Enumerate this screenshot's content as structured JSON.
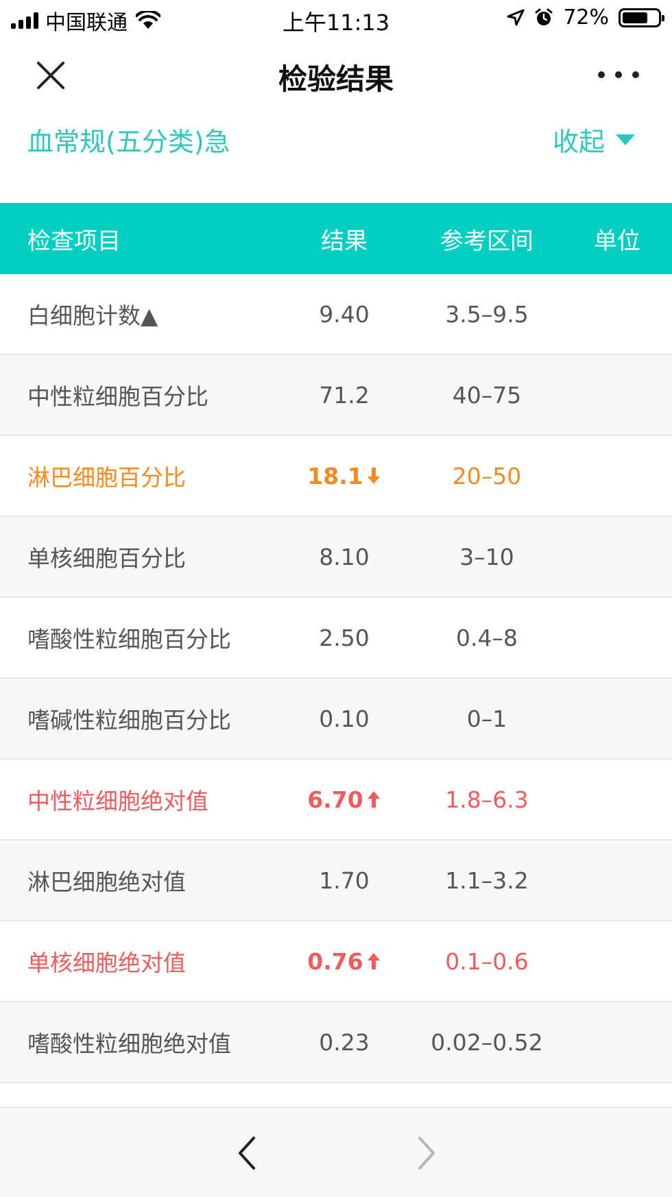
{
  "status_bar": {
    "carrier": "中国联通",
    "time": "上午11:13",
    "battery": "72%"
  },
  "nav": {
    "title": "检验结果"
  },
  "section": {
    "title": "血常规(五分类)急",
    "collapse_label": "收起"
  },
  "table": {
    "headers": {
      "name": "检查项目",
      "result": "结果",
      "range": "参考区间",
      "unit": "单位"
    },
    "rows": [
      {
        "name": "白细胞计数▲",
        "result": "9.40",
        "range": "3.5–9.5",
        "unit": "",
        "status": "normal"
      },
      {
        "name": "中性粒细胞百分比",
        "result": "71.2",
        "range": "40–75",
        "unit": "",
        "status": "normal"
      },
      {
        "name": "淋巴细胞百分比",
        "result": "18.1",
        "range": "20–50",
        "unit": "",
        "status": "low"
      },
      {
        "name": "单核细胞百分比",
        "result": "8.10",
        "range": "3–10",
        "unit": "",
        "status": "normal"
      },
      {
        "name": "嗜酸性粒细胞百分比",
        "result": "2.50",
        "range": "0.4–8",
        "unit": "",
        "status": "normal"
      },
      {
        "name": "嗜碱性粒细胞百分比",
        "result": "0.10",
        "range": "0–1",
        "unit": "",
        "status": "normal"
      },
      {
        "name": "中性粒细胞绝对值",
        "result": "6.70",
        "range": "1.8–6.3",
        "unit": "",
        "status": "high"
      },
      {
        "name": "淋巴细胞绝对值",
        "result": "1.70",
        "range": "1.1–3.2",
        "unit": "",
        "status": "normal"
      },
      {
        "name": "单核细胞绝对值",
        "result": "0.76",
        "range": "0.1–0.6",
        "unit": "",
        "status": "high"
      },
      {
        "name": "嗜酸性粒细胞绝对值",
        "result": "0.23",
        "range": "0.02–0.52",
        "unit": "",
        "status": "normal"
      }
    ]
  },
  "colors": {
    "accent": "#00cfc1",
    "low": "#f7891e",
    "high": "#f15b5b"
  },
  "icons": {
    "close": "close-icon",
    "more": "more-icon",
    "back": "chevron-left-icon",
    "forward": "chevron-right-icon"
  }
}
